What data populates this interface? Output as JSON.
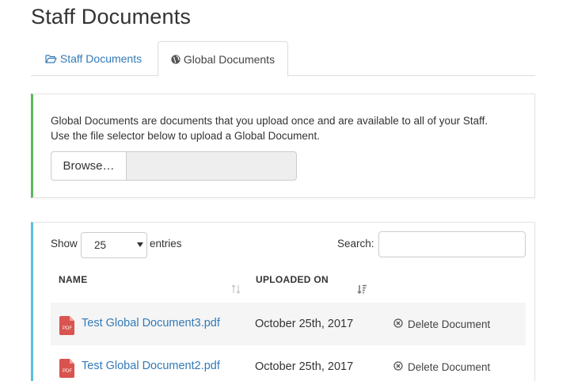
{
  "page": {
    "title": "Staff Documents"
  },
  "tabs": [
    {
      "label": "Staff Documents",
      "icon": "folder-open-icon",
      "active": false
    },
    {
      "label": "Global Documents",
      "icon": "globe-icon",
      "active": true
    }
  ],
  "upload": {
    "description_line1": "Global Documents are documents that you upload once and are available to all of your Staff.",
    "description_line2": "Use the file selector below to upload a Global Document.",
    "browse_label": "Browse…",
    "accent": "#5cb85c"
  },
  "table": {
    "accent": "#5bc0de",
    "show_label": "Show",
    "page_length": "25",
    "entries_label": "entries",
    "search_label": "Search:",
    "search_value": "",
    "columns": [
      "NAME",
      "UPLOADED ON"
    ],
    "rows": [
      {
        "name": "Test Global Document3.pdf",
        "uploaded": "October 25th, 2017",
        "action": "Delete Document"
      },
      {
        "name": "Test Global Document2.pdf",
        "uploaded": "October 25th, 2017",
        "action": "Delete Document"
      }
    ],
    "pdf_badge": "PDF"
  },
  "colors": {
    "link": "#337ab7",
    "pdf": "#d9534f"
  }
}
